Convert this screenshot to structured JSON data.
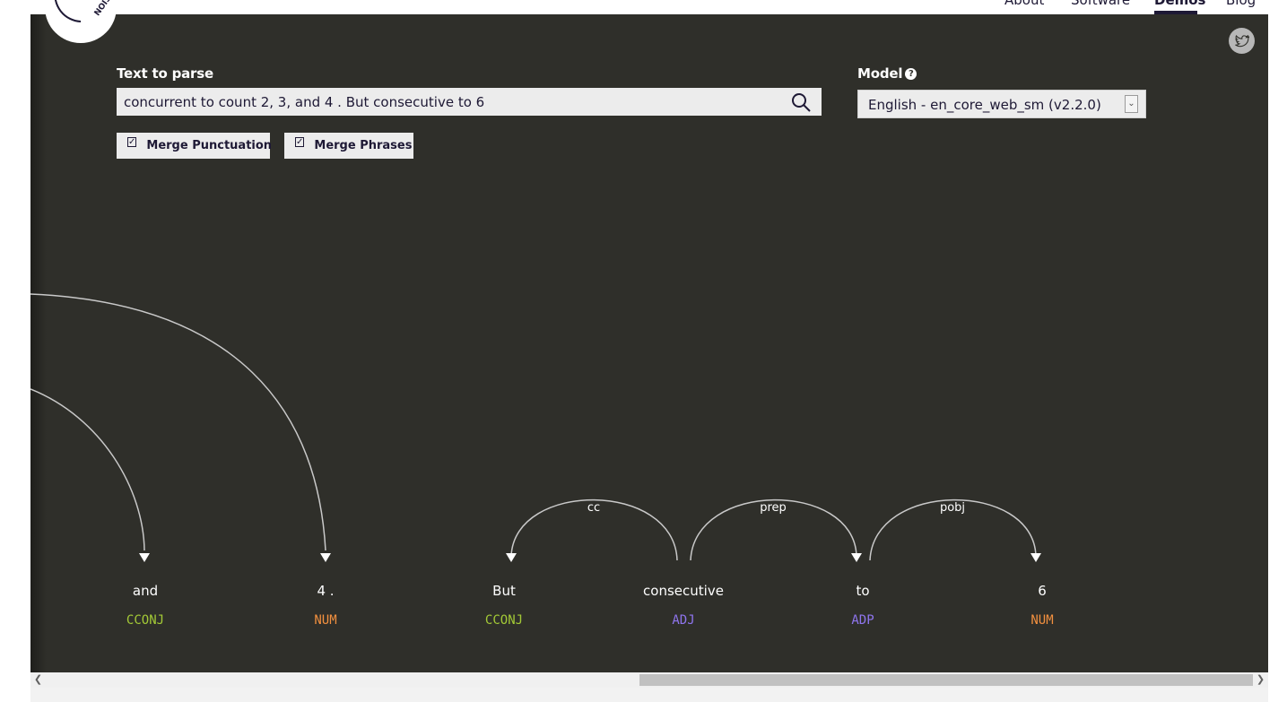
{
  "nav": {
    "items": [
      "About",
      "Software",
      "Demos",
      "Blog"
    ],
    "active": "Demos"
  },
  "logo": {
    "text": "NOIS"
  },
  "form": {
    "text_label": "Text to parse",
    "text_value": "concurrent to count 2, 3, and 4 . But consecutive to 6",
    "model_label": "Model",
    "model_value": "English - en_core_web_sm (v2.2.0)",
    "merge_punct_label": "Merge Punctuation",
    "merge_phrases_label": "Merge Phrases",
    "merge_punct_checked": true,
    "merge_phrases_checked": true
  },
  "parse": {
    "tokens": [
      {
        "word": "and",
        "tag": "CCONJ"
      },
      {
        "word": "4 .",
        "tag": "NUM"
      },
      {
        "word": "But",
        "tag": "CCONJ"
      },
      {
        "word": "consecutive",
        "tag": "ADJ"
      },
      {
        "word": "to",
        "tag": "ADP"
      },
      {
        "word": "6",
        "tag": "NUM"
      }
    ],
    "arcs": [
      {
        "label": "cc"
      },
      {
        "label": "prep"
      },
      {
        "label": "pobj"
      }
    ],
    "tag_colors": {
      "CCONJ": "#a3c936",
      "NUM": "#f2903f",
      "ADJ": "#8f75ee",
      "ADP": "#8f75ee"
    }
  },
  "colors": {
    "panel_bg": "#2f2f2a",
    "arc_stroke": "#c9c9c9",
    "nav_text": "#1e1935"
  }
}
